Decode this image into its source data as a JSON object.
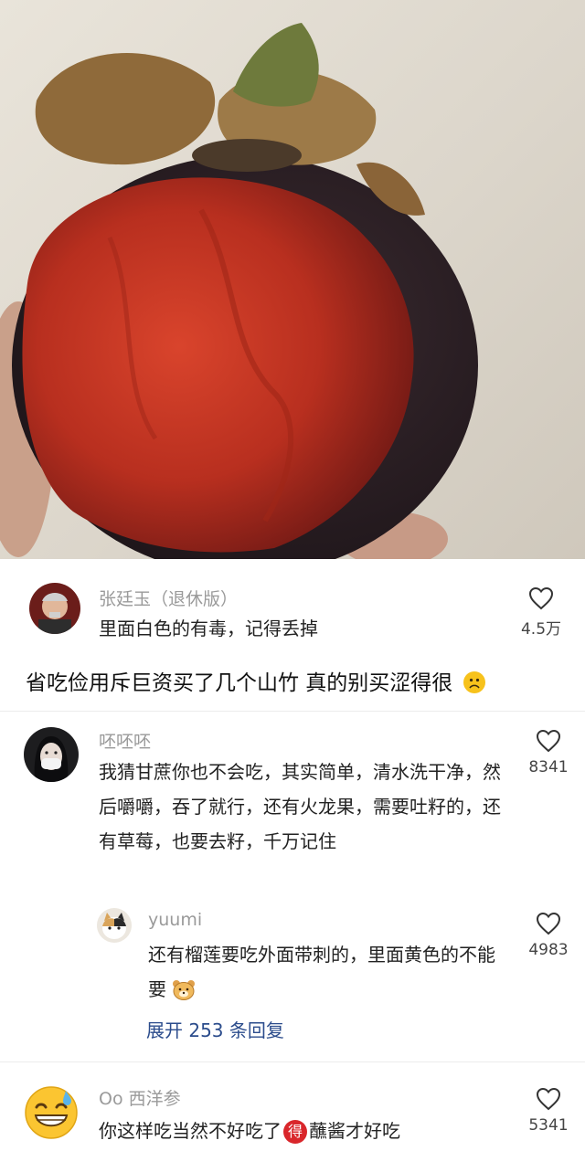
{
  "post_image": {
    "icon": "mangosteen-photo"
  },
  "caption": {
    "text": "省吃俭用斥巨资买了几个山竹 真的别买涩得很",
    "emoji": "frowning-face"
  },
  "comments": [
    {
      "username": "张廷玉（退休版）",
      "text": "里面白色的有毒，记得丢掉",
      "likes": "4.5万",
      "avatar_icon": "elderly-man-avatar"
    },
    {
      "username": "呸呸呸",
      "text": "我猜甘蔗你也不会吃，其实简单，清水洗干净，然后嚼嚼，吞了就行，还有火龙果，需要吐籽的，还有草莓，也要去籽，千万记住",
      "likes": "8341",
      "avatar_icon": "masked-girl-avatar",
      "reply": {
        "username": "yuumi",
        "text": "还有榴莲要吃外面带刺的，里面黄色的不能要",
        "likes": "4983",
        "avatar_icon": "cat-avatar",
        "emoji": "bear-face"
      },
      "expand_label": "展开 253 条回复"
    },
    {
      "username": "Oo 西洋参",
      "text_before": "你这样吃当然不好吃了",
      "badge": "得",
      "text_after": "蘸酱才好吃",
      "likes": "5341",
      "avatar_icon": "grinning-sweat-emoji-avatar"
    }
  ],
  "colors": {
    "link": "#2b4c8c",
    "username": "#9a9a9a",
    "badge": "#d9262b"
  }
}
